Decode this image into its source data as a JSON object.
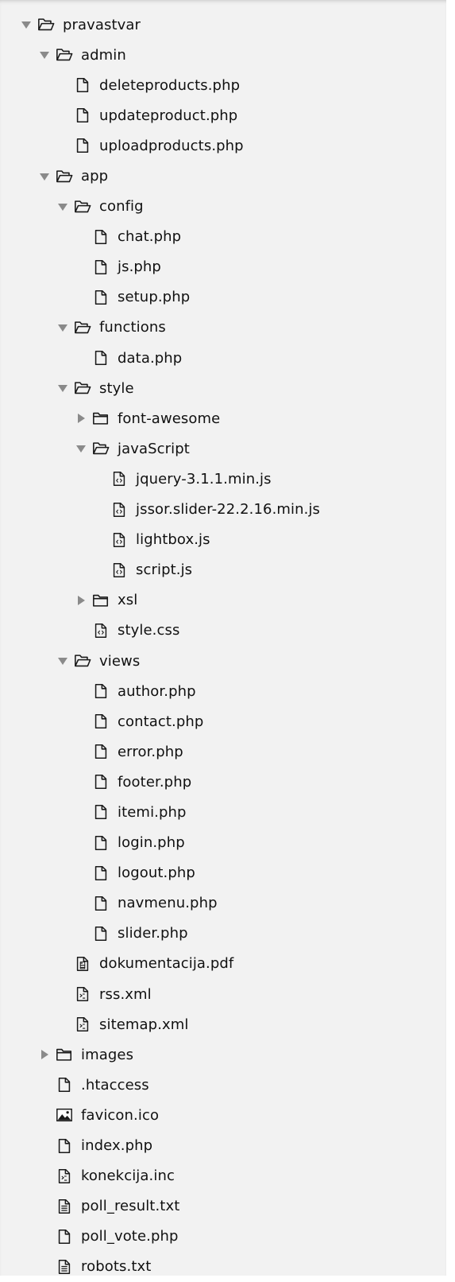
{
  "tree": {
    "rows": [
      {
        "label": "pravastvar",
        "type": "folder",
        "expanded": true,
        "depth": 0,
        "icon": "folder-open-icon"
      },
      {
        "label": "admin",
        "type": "folder",
        "expanded": true,
        "depth": 1,
        "icon": "folder-open-icon"
      },
      {
        "label": "deleteproducts.php",
        "type": "file",
        "depth": 2,
        "icon": "file-icon"
      },
      {
        "label": "updateproduct.php",
        "type": "file",
        "depth": 2,
        "icon": "file-icon"
      },
      {
        "label": "uploadproducts.php",
        "type": "file",
        "depth": 2,
        "icon": "file-icon"
      },
      {
        "label": "app",
        "type": "folder",
        "expanded": true,
        "depth": 1,
        "icon": "folder-open-icon"
      },
      {
        "label": "config",
        "type": "folder",
        "expanded": true,
        "depth": 2,
        "icon": "folder-open-icon"
      },
      {
        "label": "chat.php",
        "type": "file",
        "depth": 3,
        "icon": "file-icon"
      },
      {
        "label": "js.php",
        "type": "file",
        "depth": 3,
        "icon": "file-icon"
      },
      {
        "label": "setup.php",
        "type": "file",
        "depth": 3,
        "icon": "file-icon"
      },
      {
        "label": "functions",
        "type": "folder",
        "expanded": true,
        "depth": 2,
        "icon": "folder-open-icon"
      },
      {
        "label": "data.php",
        "type": "file",
        "depth": 3,
        "icon": "file-icon"
      },
      {
        "label": "style",
        "type": "folder",
        "expanded": true,
        "depth": 2,
        "icon": "folder-open-icon"
      },
      {
        "label": "font-awesome",
        "type": "folder",
        "expanded": false,
        "depth": 3,
        "icon": "folder-closed-icon"
      },
      {
        "label": "javaScript",
        "type": "folder",
        "expanded": true,
        "depth": 3,
        "icon": "folder-open-icon"
      },
      {
        "label": "jquery-3.1.1.min.js",
        "type": "file",
        "depth": 4,
        "icon": "code-file-icon"
      },
      {
        "label": "jssor.slider-22.2.16.min.js",
        "type": "file",
        "depth": 4,
        "icon": "code-file-icon"
      },
      {
        "label": "lightbox.js",
        "type": "file",
        "depth": 4,
        "icon": "code-file-icon"
      },
      {
        "label": "script.js",
        "type": "file",
        "depth": 4,
        "icon": "code-file-icon"
      },
      {
        "label": "xsl",
        "type": "folder",
        "expanded": false,
        "depth": 3,
        "icon": "folder-closed-icon"
      },
      {
        "label": "style.css",
        "type": "file",
        "depth": 3,
        "icon": "code-file-icon"
      },
      {
        "label": "views",
        "type": "folder",
        "expanded": true,
        "depth": 2,
        "icon": "folder-open-icon"
      },
      {
        "label": "author.php",
        "type": "file",
        "depth": 3,
        "icon": "file-icon"
      },
      {
        "label": "contact.php",
        "type": "file",
        "depth": 3,
        "icon": "file-icon"
      },
      {
        "label": "error.php",
        "type": "file",
        "depth": 3,
        "icon": "file-icon"
      },
      {
        "label": "footer.php",
        "type": "file",
        "depth": 3,
        "icon": "file-icon"
      },
      {
        "label": "itemi.php",
        "type": "file",
        "depth": 3,
        "icon": "file-icon"
      },
      {
        "label": "login.php",
        "type": "file",
        "depth": 3,
        "icon": "file-icon"
      },
      {
        "label": "logout.php",
        "type": "file",
        "depth": 3,
        "icon": "file-icon"
      },
      {
        "label": "navmenu.php",
        "type": "file",
        "depth": 3,
        "icon": "file-icon"
      },
      {
        "label": "slider.php",
        "type": "file",
        "depth": 3,
        "icon": "file-icon"
      },
      {
        "label": "dokumentacija.pdf",
        "type": "file",
        "depth": 2,
        "icon": "pdf-file-icon"
      },
      {
        "label": "rss.xml",
        "type": "file",
        "depth": 2,
        "icon": "xml-file-icon"
      },
      {
        "label": "sitemap.xml",
        "type": "file",
        "depth": 2,
        "icon": "xml-file-icon"
      },
      {
        "label": "images",
        "type": "folder",
        "expanded": false,
        "depth": 1,
        "icon": "folder-closed-icon"
      },
      {
        "label": ".htaccess",
        "type": "file",
        "depth": 1,
        "icon": "file-icon"
      },
      {
        "label": "favicon.ico",
        "type": "file",
        "depth": 1,
        "icon": "image-file-icon"
      },
      {
        "label": "index.php",
        "type": "file",
        "depth": 1,
        "icon": "file-icon"
      },
      {
        "label": "konekcija.inc",
        "type": "file",
        "depth": 1,
        "icon": "xml-file-icon"
      },
      {
        "label": "poll_result.txt",
        "type": "file",
        "depth": 1,
        "icon": "text-file-icon"
      },
      {
        "label": "poll_vote.php",
        "type": "file",
        "depth": 1,
        "icon": "file-icon"
      },
      {
        "label": "robots.txt",
        "type": "file",
        "depth": 1,
        "icon": "text-file-icon"
      }
    ]
  }
}
